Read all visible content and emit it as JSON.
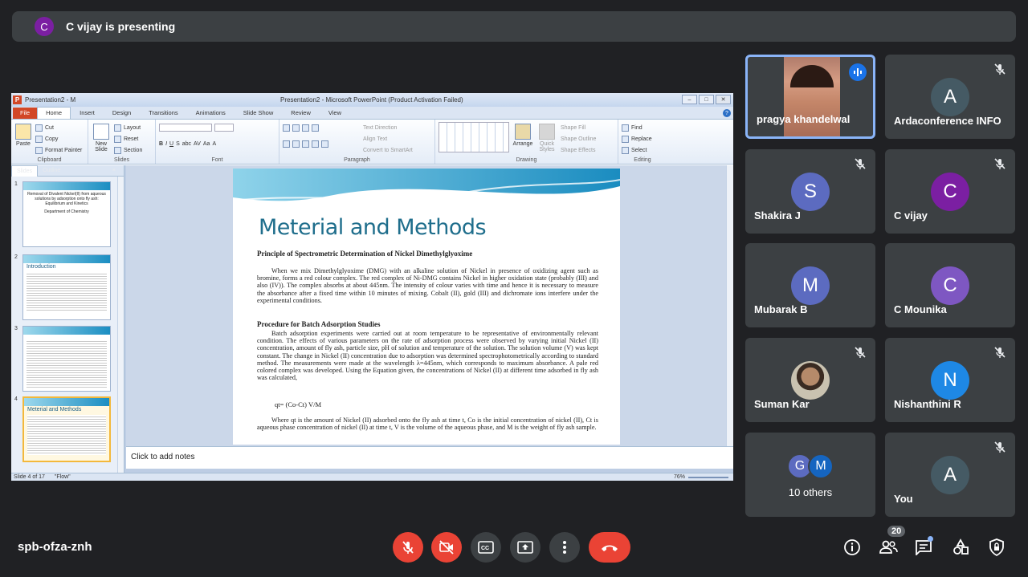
{
  "banner": {
    "initial": "C",
    "text": "C vijay is presenting"
  },
  "ppt": {
    "doc_tab": "Presentation2 - M",
    "window_title": "Presentation2 - Microsoft PowerPoint (Product Activation Failed)",
    "tabs": [
      "File",
      "Home",
      "Insert",
      "Design",
      "Transitions",
      "Animations",
      "Slide Show",
      "Review",
      "View"
    ],
    "ribbon": {
      "paste": "Paste",
      "cut": "Cut",
      "copy": "Copy",
      "format_painter": "Format Painter",
      "clipboard": "Clipboard",
      "new_slide": "New Slide",
      "layout": "Layout",
      "reset": "Reset",
      "section": "Section",
      "slides": "Slides",
      "font": "Font",
      "paragraph": "Paragraph",
      "text_direction": "Text Direction",
      "align_text": "Align Text",
      "convert_smartart": "Convert to SmartArt",
      "arrange": "Arrange",
      "quick_styles": "Quick Styles",
      "shape_fill": "Shape Fill",
      "shape_outline": "Shape Outline",
      "shape_effects": "Shape Effects",
      "drawing": "Drawing",
      "find": "Find",
      "replace": "Replace",
      "select": "Select",
      "editing": "Editing",
      "font_style_buttons": [
        "B",
        "I",
        "U",
        "S",
        "abc",
        "AV",
        "Aa",
        "A"
      ]
    },
    "panel_tabs": {
      "slides": "Slides",
      "outline": "Outline",
      "close": "×"
    },
    "thumbnails": [
      {
        "num": "1",
        "title": "Removal of Divalent Nickel(II) from aqueous solutions by adsorption onto fly ash: Equilibrium and Kinetics",
        "sub": "Department of Chemistry"
      },
      {
        "num": "2",
        "title": "Introduction"
      },
      {
        "num": "3",
        "title": ""
      },
      {
        "num": "4",
        "title": "Meterial and Methods"
      }
    ],
    "slide": {
      "heading": "Meterial and Methods",
      "sub1": "Principle of Spectrometric Determination of Nickel Dimethylglyoxime",
      "para1": "When we mix Dimethylglyoxime (DMG) with an alkaline solution of Nickel in presence of oxidizing agent such as bromine, forms a red colour complex. The red complex of Ni-DMG contains Nickel in higher oxidation state (probably (III) and also (IV)). The complex absorbs at about 445nm. The intensity of colour varies with time and hence it is necessary to measure the absorbance after a fixed time within 10 minutes of mixing. Cobalt (II), gold (III) and dichromate ions interfere under the experimental conditions.",
      "sub2": "Procedure for Batch Adsorption Studies",
      "para2": "Batch adsorption experiments were carried out at room temperature to be representative of environmentally relevant condition. The effects of various parameters on the rate of adsorption process were observed by varying initial Nickel (II) concentration, amount of fly ash, particle size, pH of solution and temperature of the solution. The solution volume (V) was kept constant. The change in Nickel (II) concentration due to adsorption was determined spectrophotometrically according to standard method. The measurements were made at the wavelength λ=445nm, which corresponds to maximum absorbance. A pale red colored complex was developed. Using the Equation given, the concentrations of Nickel (II) at different time adsorbed in fly ash was calculated,",
      "equation": "qt= (Co-Ct) V/M",
      "para3": "Where qt is the amount of Nickel (II) adsorbed onto the fly ash at time t, Co is the initial concentration of nickel (II), Ct is aqueous phase concentration of nickel (II) at time t, V is the volume of the aqueous phase, and M is the weight of fly ash sample."
    },
    "notes_placeholder": "Click to add notes",
    "status": {
      "slide": "Slide 4 of 17",
      "theme": "\"Flow\"",
      "zoom": "76%"
    }
  },
  "participants": [
    {
      "name": "pragya khandelwal",
      "type": "video",
      "speaking": true
    },
    {
      "name": "Ardaconference INFO",
      "initial": "A",
      "color": "#455a64",
      "muted": true
    },
    {
      "name": "Shakira J",
      "initial": "S",
      "color": "#5c6bc0",
      "muted": true
    },
    {
      "name": "C vijay",
      "initial": "C",
      "color": "#7b1fa2",
      "muted": true
    },
    {
      "name": "Mubarak B",
      "initial": "M",
      "color": "#5c6bc0",
      "muted": true
    },
    {
      "name": "C Mounika",
      "initial": "C",
      "color": "#7e57c2",
      "muted": true
    },
    {
      "name": "Suman Kar",
      "type": "photo",
      "muted": true
    },
    {
      "name": "Nishanthini R",
      "initial": "N",
      "color": "#1e88e5",
      "muted": true
    },
    {
      "name": "10 others",
      "type": "others",
      "initials": [
        "G",
        "M"
      ],
      "colors": [
        "#5c6bc0",
        "#1565c0"
      ]
    },
    {
      "name": "You",
      "initial": "A",
      "color": "#455a64",
      "muted": true
    }
  ],
  "bottom": {
    "meeting_code": "spb-ofza-znh",
    "participant_count": "20"
  },
  "colors": {
    "background": "#202124",
    "tile": "#3c4043",
    "danger": "#ea4335",
    "accent": "#8ab4f8"
  }
}
